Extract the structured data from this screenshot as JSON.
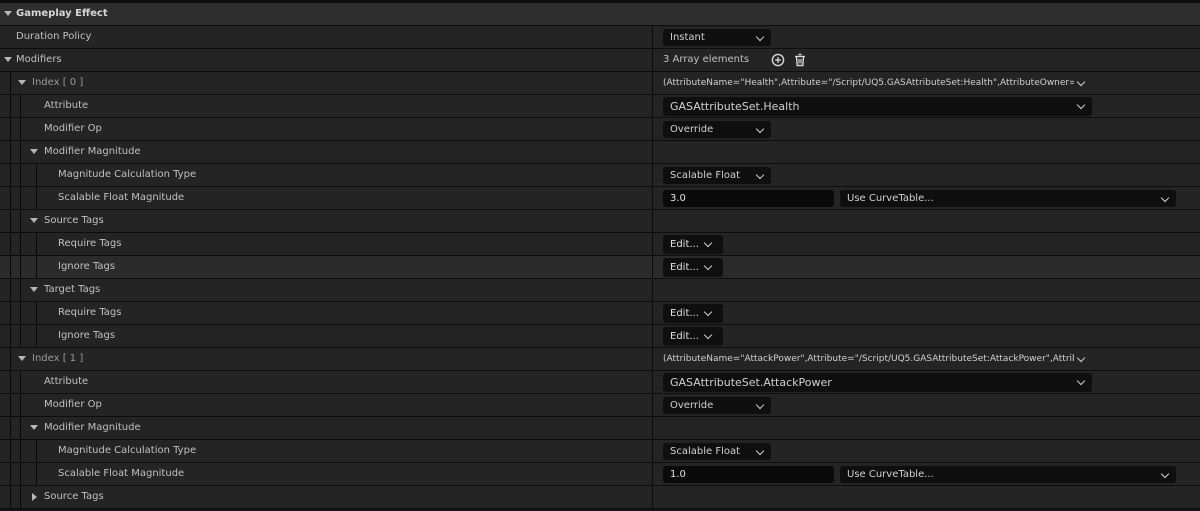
{
  "category": {
    "title": "Gameplay Effect"
  },
  "duration": {
    "label": "Duration Policy",
    "value": "Instant"
  },
  "modifiers": {
    "label": "Modifiers",
    "count_text": "3 Array elements"
  },
  "index0": {
    "label": "Index [ 0 ]",
    "summary": "(AttributeName=\"Health\",Attribute=\"/Script/UQ5.GASAttributeSet:Health\",AttributeOwner=/S",
    "attribute_label": "Attribute",
    "attribute_value": "GASAttributeSet.Health",
    "op_label": "Modifier Op",
    "op_value": "Override",
    "magnitude_label": "Modifier Magnitude",
    "calc_label": "Magnitude Calculation Type",
    "calc_value": "Scalable Float",
    "sfm_label": "Scalable Float Magnitude",
    "sfm_value": "3.0",
    "curve_value": "Use CurveTable...",
    "source_tags": "Source Tags",
    "require_tags": "Require Tags",
    "ignore_tags": "Ignore Tags",
    "target_tags": "Target Tags",
    "edit": "Edit..."
  },
  "index1": {
    "label": "Index [ 1 ]",
    "summary": "(AttributeName=\"AttackPower\",Attribute=\"/Script/UQ5.GASAttributeSet:AttackPower\",Attrib",
    "attribute_label": "Attribute",
    "attribute_value": "GASAttributeSet.AttackPower",
    "op_label": "Modifier Op",
    "op_value": "Override",
    "magnitude_label": "Modifier Magnitude",
    "calc_label": "Magnitude Calculation Type",
    "calc_value": "Scalable Float",
    "sfm_label": "Scalable Float Magnitude",
    "sfm_value": "1.0",
    "curve_value": "Use CurveTable...",
    "source_tags": "Source Tags"
  },
  "icons": {
    "add": "add-element-icon",
    "delete": "trash-icon"
  }
}
